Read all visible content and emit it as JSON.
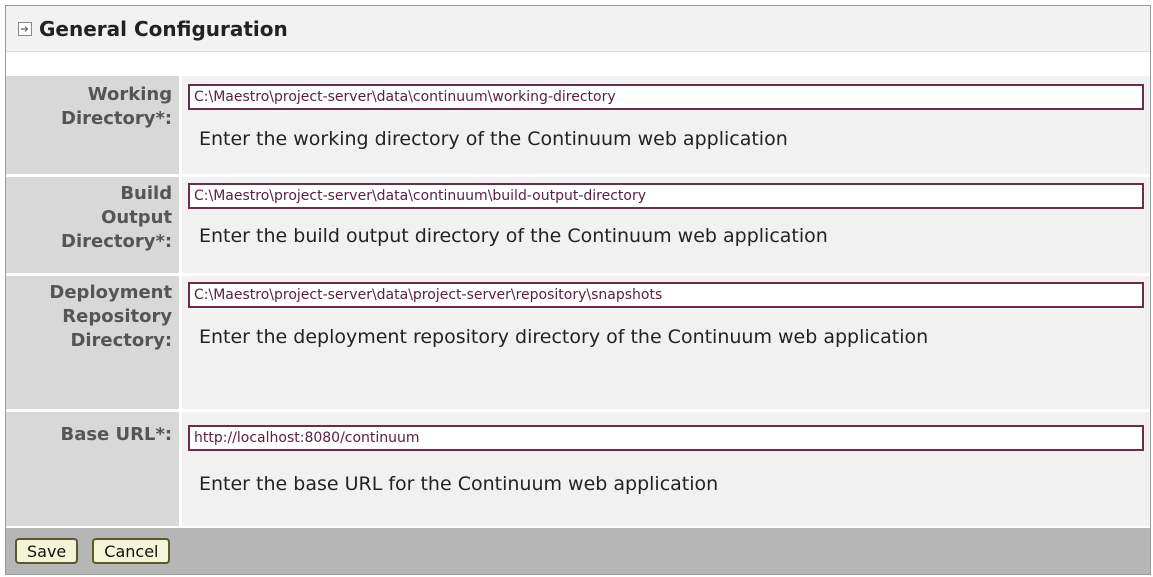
{
  "section": {
    "title": "General Configuration",
    "collapse_icon": "collapse-arrow-icon"
  },
  "fields": [
    {
      "label_lines": [
        "Working",
        "Directory*:"
      ],
      "value": "C:\\Maestro\\project-server\\data\\continuum\\working-directory",
      "help": "Enter the working directory of the Continuum web application"
    },
    {
      "label_lines": [
        "Build",
        "Output",
        "Directory*:"
      ],
      "value": "C:\\Maestro\\project-server\\data\\continuum\\build-output-directory",
      "help": "Enter the build output directory of the Continuum web application"
    },
    {
      "label_lines": [
        "Deployment",
        "Repository",
        "Directory:"
      ],
      "value": "C:\\Maestro\\project-server\\data\\project-server\\repository\\snapshots",
      "help": "Enter the deployment repository directory of the Continuum web application"
    },
    {
      "label_lines": [
        "Base URL*:"
      ],
      "value": "http://localhost:8080/continuum",
      "help": "Enter the base URL for the Continuum web application"
    }
  ],
  "buttons": {
    "save": "Save",
    "cancel": "Cancel"
  }
}
